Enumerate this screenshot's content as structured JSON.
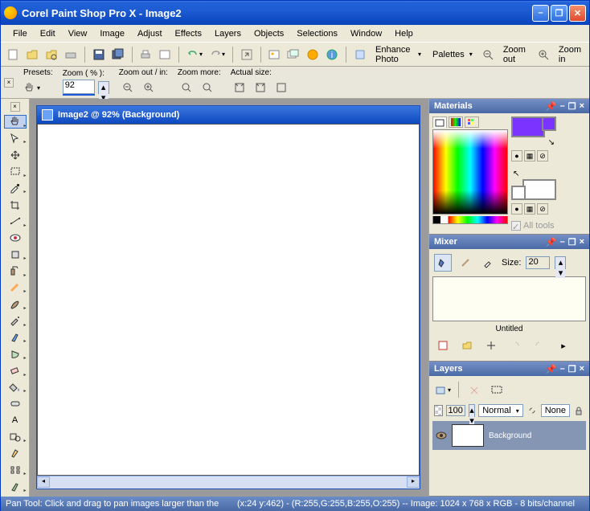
{
  "window": {
    "title": "Corel Paint Shop Pro X - Image2"
  },
  "menu": [
    "File",
    "Edit",
    "View",
    "Image",
    "Adjust",
    "Effects",
    "Layers",
    "Objects",
    "Selections",
    "Window",
    "Help"
  ],
  "toolbar": {
    "enhance_photo": "Enhance Photo",
    "palettes": "Palettes",
    "zoom_out": "Zoom out",
    "zoom_in": "Zoom in"
  },
  "options": {
    "presets_label": "Presets:",
    "zoom_pct_label": "Zoom ( % ):",
    "zoom_value": "92",
    "zoom_io_label": "Zoom out / in:",
    "zoom_more_label": "Zoom more:",
    "actual_size_label": "Actual size:"
  },
  "document": {
    "title": "Image2  @   92% (Background)"
  },
  "panels": {
    "materials": {
      "title": "Materials",
      "all_tools": "All tools",
      "fg_color": "#7b33ff",
      "bg_color": "#ffffff"
    },
    "mixer": {
      "title": "Mixer",
      "size_label": "Size:",
      "size_value": "20",
      "untitled": "Untitled"
    },
    "layers": {
      "title": "Layers",
      "opacity": "100",
      "blend_mode": "Normal",
      "link": "None",
      "layer_name": "Background"
    }
  },
  "status": {
    "tool": "Pan Tool: Click and drag to pan images larger than the",
    "coords": "(x:24 y:462) - (R:255,G:255,B:255,O:255) -- Image:  1024 x 768 x RGB - 8 bits/channel"
  }
}
